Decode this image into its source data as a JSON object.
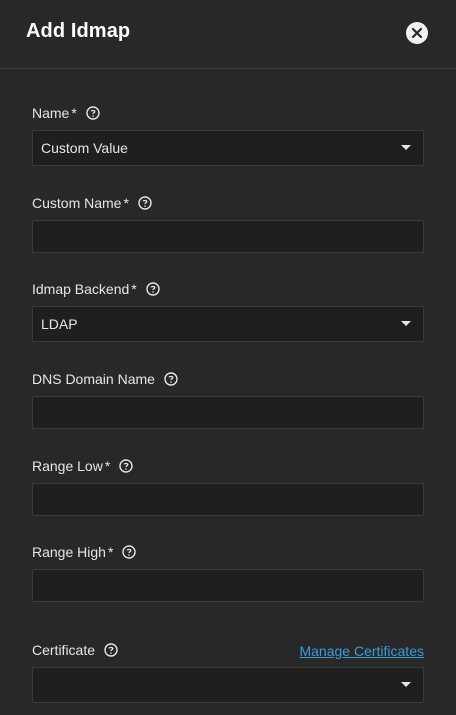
{
  "dialog": {
    "title": "Add Idmap",
    "close_icon": "close-circle-icon"
  },
  "colors": {
    "background": "#282828",
    "input_background": "#1f1f1f",
    "link": "#3a9bdc"
  },
  "fields": {
    "name": {
      "label": "Name",
      "required_mark": "*",
      "value": "Custom Value"
    },
    "custom_name": {
      "label": "Custom Name",
      "required_mark": "*",
      "value": ""
    },
    "idmap_backend": {
      "label": "Idmap Backend",
      "required_mark": "*",
      "value": "LDAP"
    },
    "dns_domain_name": {
      "label": "DNS Domain Name",
      "value": ""
    },
    "range_low": {
      "label": "Range Low",
      "required_mark": "*",
      "value": ""
    },
    "range_high": {
      "label": "Range High",
      "required_mark": "*",
      "value": ""
    },
    "certificate": {
      "label": "Certificate",
      "value": "",
      "link": "Manage Certificates"
    }
  }
}
